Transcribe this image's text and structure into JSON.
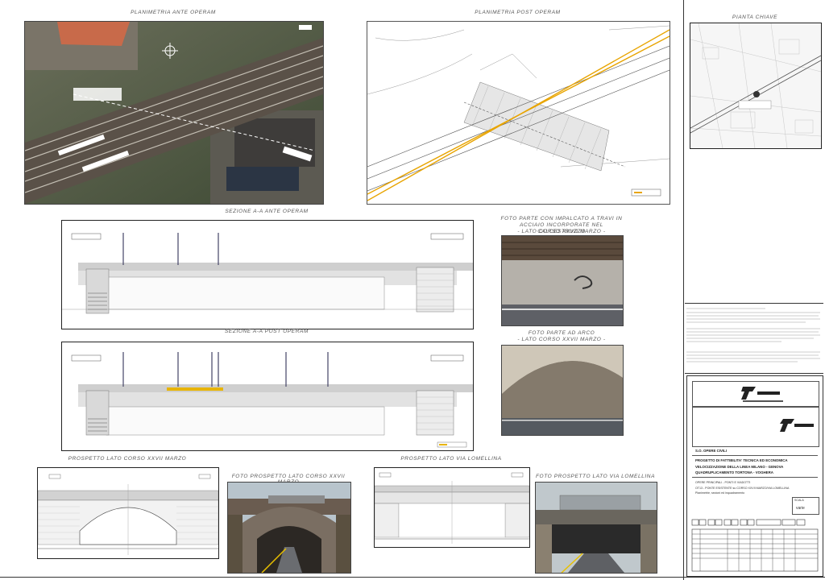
{
  "titles": {
    "plan_ante": "PLANIMETRIA ANTE OPERAM",
    "plan_post": "PLANIMETRIA POST OPERAM",
    "key_plan": "PIANTA CHIAVE",
    "sec_ante": "SEZIONE A-A ANTE OPERAM",
    "sec_post": "SEZIONE A-A POST OPERAM",
    "photo1": "FOTO PARTE CON IMPALCATO A TRAVI IN ACCIAIO INCORPORATE NEL CALCESTRUZZO",
    "photo1_sub": "- LATO CORSO XXVII MARZO -",
    "photo2": "FOTO PARTE AD ARCO",
    "photo2_sub": "- LATO CORSO XXVII MARZO -",
    "prosp1": "PROSPETTO LATO CORSO XXVII MARZO",
    "foto_prosp1": "FOTO PROSPETTO LATO CORSO XXVII MARZO",
    "prosp2": "PROSPETTO LATO VIA LOMELLINA",
    "foto_prosp2": "FOTO PROSPETTO LATO VIA LOMELLINA"
  },
  "title_block": {
    "so": "S.O. OPERE CIVILI",
    "project": "PROGETTO DI FATTIBILITA' TECNICA ED ECONOMICA",
    "line1": "VELOCIZZAZIONE DELLA LINEA MILANO - GENOVA",
    "line2": "QUADRUPLICAMENTO TORTONA - VOGHERA",
    "works": "OPERE PRINCIPALI - PONTI E VIADOTTI",
    "desc1": "OT13 - PONTE ESISTENTE su CORSO XXVII MARZO/VIA LOMELLINA",
    "desc2": "Planimetrie, sezioni ed inquadramento",
    "scale_label": "SCALA",
    "scale_value": "varie"
  }
}
